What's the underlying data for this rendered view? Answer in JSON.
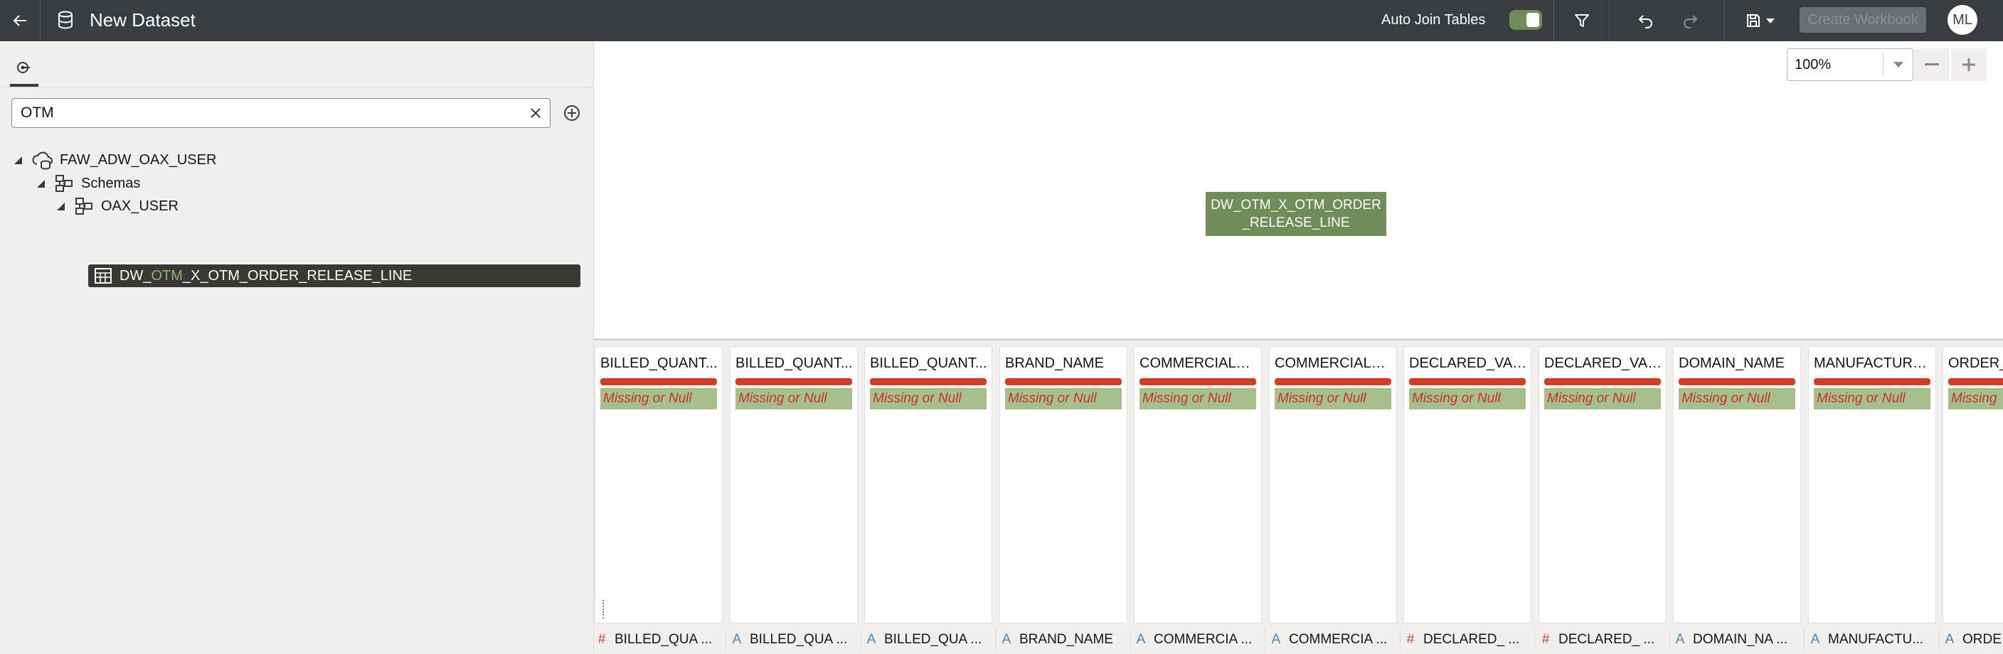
{
  "header": {
    "title": "New Dataset",
    "auto_join_label": "Auto Join Tables",
    "auto_join_on": true,
    "create_workbook_label": "Create Workbook",
    "avatar_initials": "ML"
  },
  "left_panel": {
    "search_value": "OTM",
    "tree": {
      "connection": "FAW_ADW_OAX_USER",
      "schemas_label": "Schemas",
      "schema": "OAX_USER",
      "table_prefix": "DW_",
      "table_match": "OTM",
      "table_suffix": "_X_OTM_ORDER_RELEASE_LINE"
    }
  },
  "canvas": {
    "zoom": "100%",
    "node_label": "DW_OTM_X_OTM_ORDER\n_RELEASE_LINE"
  },
  "columns": [
    {
      "name": "BILLED_QUANT...",
      "quality": "Missing or Null",
      "type": "#",
      "footer": "BILLED_QUA ..."
    },
    {
      "name": "BILLED_QUANT...",
      "quality": "Missing or Null",
      "type": "A",
      "footer": "BILLED_QUA ..."
    },
    {
      "name": "BILLED_QUANT...",
      "quality": "Missing or Null",
      "type": "A",
      "footer": "BILLED_QUA ..."
    },
    {
      "name": "BRAND_NAME",
      "quality": "Missing or Null",
      "type": "A",
      "footer": "BRAND_NAME"
    },
    {
      "name": "COMMERCIAL_I...",
      "quality": "Missing or Null",
      "type": "A",
      "footer": "COMMERCIA ..."
    },
    {
      "name": "COMMERCIAL_I...",
      "quality": "Missing or Null",
      "type": "A",
      "footer": "COMMERCIA ..."
    },
    {
      "name": "DECLARED_VAL...",
      "quality": "Missing or Null",
      "type": "#",
      "footer": "DECLARED_ ..."
    },
    {
      "name": "DECLARED_VAL...",
      "quality": "Missing or Null",
      "type": "#",
      "footer": "DECLARED_ ..."
    },
    {
      "name": "DOMAIN_NAME",
      "quality": "Missing or Null",
      "type": "A",
      "footer": "DOMAIN_NA ..."
    },
    {
      "name": "MANUFACTURE...",
      "quality": "Missing or Null",
      "type": "A",
      "footer": "MANUFACTU..."
    },
    {
      "name": "ORDER_",
      "quality": "Missing",
      "type": "A",
      "footer": "ORDE"
    }
  ]
}
